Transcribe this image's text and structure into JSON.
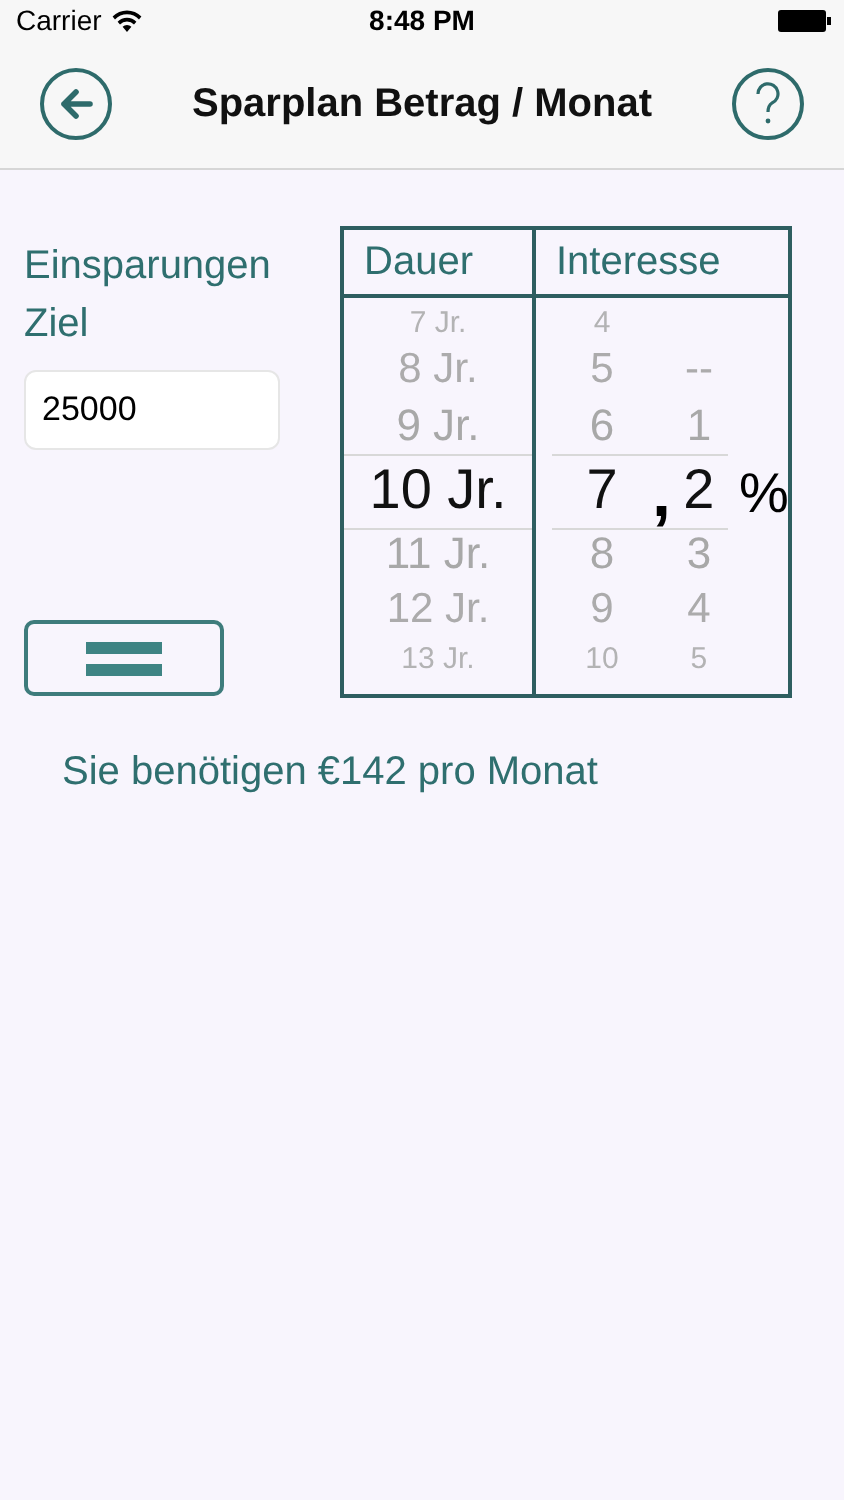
{
  "status_bar": {
    "carrier": "Carrier",
    "time": "8:48 PM"
  },
  "nav": {
    "title": "Sparplan Betrag / Monat"
  },
  "goal": {
    "label": "Einsparungen Ziel",
    "value": "25000"
  },
  "picker": {
    "columns": [
      {
        "header": "Dauer",
        "wheels": [
          {
            "items": [
              {
                "label": "7 Jr.",
                "selected": false
              },
              {
                "label": "8 Jr.",
                "selected": false
              },
              {
                "label": "9 Jr.",
                "selected": false
              },
              {
                "label": "10 Jr.",
                "selected": true
              },
              {
                "label": "11 Jr.",
                "selected": false
              },
              {
                "label": "12 Jr.",
                "selected": false
              },
              {
                "label": "13 Jr.",
                "selected": false
              }
            ]
          }
        ]
      },
      {
        "header": "Interesse",
        "wheels": [
          {
            "items": [
              {
                "label": "4",
                "selected": false
              },
              {
                "label": "5",
                "selected": false
              },
              {
                "label": "6",
                "selected": false
              },
              {
                "label": "7",
                "selected": true
              },
              {
                "label": "8",
                "selected": false
              },
              {
                "label": "9",
                "selected": false
              },
              {
                "label": "10",
                "selected": false
              }
            ]
          },
          {
            "separator": ","
          },
          {
            "items": [
              {
                "label": "--",
                "selected": false
              },
              {
                "label": "1",
                "selected": false
              },
              {
                "label": "2",
                "selected": true
              },
              {
                "label": "3",
                "selected": false
              },
              {
                "label": "4",
                "selected": false
              },
              {
                "label": "5",
                "selected": false
              }
            ]
          },
          {
            "suffix": "%"
          }
        ]
      }
    ]
  },
  "result": "Sie benötigen €142 pro Monat"
}
